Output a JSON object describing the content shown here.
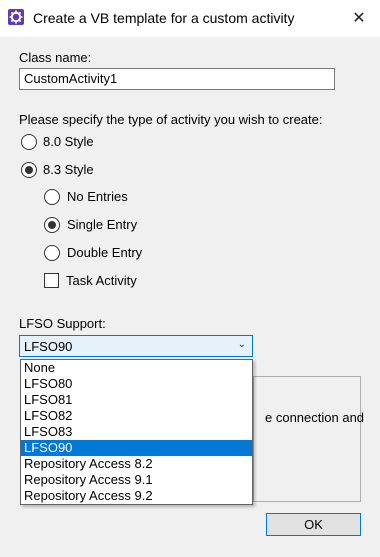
{
  "window": {
    "title": "Create a VB template for a custom activity",
    "close_glyph": "✕"
  },
  "class_name": {
    "label": "Class name:",
    "value": "CustomActivity1"
  },
  "activity_type": {
    "prompt": "Please specify the type of activity you wish to create:",
    "styles": [
      {
        "label": "8.0 Style",
        "checked": false
      },
      {
        "label": "8.3 Style",
        "checked": true
      }
    ],
    "entries": [
      {
        "label": "No Entries",
        "checked": false
      },
      {
        "label": "Single Entry",
        "checked": true
      },
      {
        "label": "Double Entry",
        "checked": false
      }
    ],
    "task_activity": {
      "label": "Task Activity",
      "checked": false
    }
  },
  "lfso": {
    "label": "LFSO Support:",
    "selected": "LFSO90",
    "options": [
      "None",
      "LFSO80",
      "LFSO81",
      "LFSO82",
      "LFSO83",
      "LFSO90",
      "Repository Access 8.2",
      "Repository Access 9.1",
      "Repository Access 9.2"
    ],
    "highlighted_index": 5
  },
  "groupbox_partial_text": "e connection and",
  "ok_button": {
    "label": "OK"
  },
  "colors": {
    "accent": "#0078d7",
    "dialog_bg": "#f0f0f0",
    "app_icon": "#5b3fb0"
  },
  "icons": {
    "app": "gear-icon",
    "close": "close-icon",
    "dropdown": "chevron-down-icon"
  }
}
